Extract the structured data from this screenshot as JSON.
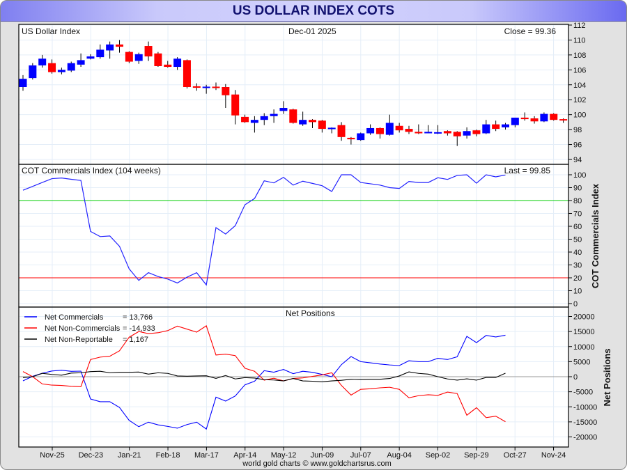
{
  "title": "US DOLLAR INDEX COTS",
  "colors": {
    "up": "#0000ff",
    "down": "#ff0000",
    "commercials": "#0000ff",
    "non_commercials": "#ff0000",
    "non_reportable": "#000000",
    "grid": "#e4eef8",
    "line80": "#00cc00",
    "line20": "#ff0000"
  },
  "credit": "world gold charts © www.goldchartsrus.com",
  "chart_data": [
    {
      "type": "candlestick",
      "title": "US Dollar Index",
      "date_label": "Dec-01  2025",
      "close_label": "Close = 99.36",
      "ylim": [
        94,
        112
      ],
      "yticks": [
        "94",
        "96",
        "98",
        "100",
        "102",
        "104",
        "106",
        "108",
        "110",
        "112"
      ],
      "ohlc": [
        [
          103.7,
          105.3,
          103.2,
          104.8
        ],
        [
          104.9,
          106.9,
          104.7,
          106.6
        ],
        [
          106.6,
          108.0,
          106.3,
          107.5
        ],
        [
          106.9,
          107.4,
          105.5,
          105.7
        ],
        [
          105.7,
          106.3,
          105.4,
          106.0
        ],
        [
          105.9,
          107.1,
          105.7,
          106.9
        ],
        [
          106.7,
          108.2,
          106.4,
          107.3
        ],
        [
          107.5,
          108.1,
          107.4,
          107.8
        ],
        [
          107.7,
          109.4,
          107.5,
          108.7
        ],
        [
          108.6,
          109.8,
          107.5,
          109.4
        ],
        [
          109.4,
          110.0,
          108.3,
          109.1
        ],
        [
          108.4,
          108.5,
          106.9,
          107.1
        ],
        [
          107.2,
          108.3,
          106.8,
          108.1
        ],
        [
          109.2,
          109.8,
          107.2,
          107.8
        ],
        [
          108.2,
          108.4,
          106.4,
          106.5
        ],
        [
          106.7,
          107.2,
          106.3,
          106.4
        ],
        [
          106.4,
          107.7,
          106.0,
          107.5
        ],
        [
          107.3,
          107.4,
          103.5,
          103.7
        ],
        [
          103.8,
          104.2,
          103.2,
          103.6
        ],
        [
          103.7,
          104.0,
          102.8,
          103.75
        ],
        [
          103.75,
          104.3,
          103.3,
          103.6
        ],
        [
          103.7,
          104.1,
          100.9,
          102.6
        ],
        [
          102.7,
          103.3,
          98.7,
          99.9
        ],
        [
          99.7,
          100.0,
          98.9,
          99.0
        ],
        [
          98.9,
          99.8,
          97.6,
          99.3
        ],
        [
          99.3,
          100.2,
          98.6,
          99.8
        ],
        [
          99.8,
          100.7,
          98.9,
          100.1
        ],
        [
          100.5,
          101.8,
          100.1,
          100.9
        ],
        [
          100.7,
          100.8,
          98.8,
          98.9
        ],
        [
          98.7,
          100.4,
          98.5,
          99.3
        ],
        [
          99.3,
          99.4,
          98.2,
          99.0
        ],
        [
          99.2,
          99.3,
          97.6,
          98.1
        ],
        [
          98.2,
          98.3,
          97.5,
          98.25
        ],
        [
          98.6,
          99.0,
          96.5,
          97.0
        ],
        [
          96.9,
          97.0,
          96.0,
          96.7
        ],
        [
          96.6,
          97.6,
          96.5,
          97.5
        ],
        [
          97.5,
          98.7,
          97.3,
          98.2
        ],
        [
          98.2,
          98.3,
          96.8,
          97.4
        ],
        [
          97.3,
          100.0,
          97.2,
          98.9
        ],
        [
          98.5,
          98.9,
          97.6,
          97.9
        ],
        [
          98.1,
          98.5,
          97.4,
          97.7
        ],
        [
          97.7,
          98.7,
          97.4,
          97.5
        ],
        [
          97.5,
          98.6,
          97.5,
          97.7
        ],
        [
          97.55,
          98.6,
          97.4,
          97.65
        ],
        [
          97.8,
          97.9,
          97.2,
          97.5
        ],
        [
          97.7,
          97.8,
          95.8,
          97.1
        ],
        [
          97.2,
          98.3,
          96.8,
          97.8
        ],
        [
          97.9,
          98.0,
          97.1,
          97.4
        ],
        [
          97.5,
          99.3,
          97.4,
          98.7
        ],
        [
          98.7,
          99.2,
          97.8,
          98.1
        ],
        [
          98.3,
          98.9,
          98.0,
          98.7
        ],
        [
          98.6,
          99.6,
          98.3,
          99.6
        ],
        [
          99.6,
          100.3,
          99.2,
          99.4
        ],
        [
          99.5,
          99.8,
          98.8,
          99.1
        ],
        [
          99.1,
          100.3,
          99.0,
          100.1
        ],
        [
          100.1,
          100.2,
          99.2,
          99.3
        ],
        [
          99.4,
          99.5,
          98.9,
          99.36
        ]
      ]
    },
    {
      "type": "line",
      "title": "COT Commercials Index (104 weeks)",
      "last_label": "Last = 99.85",
      "ylabel": "COT Commercials Index",
      "ylim": [
        0,
        100
      ],
      "yticks": [
        "0",
        "10",
        "20",
        "30",
        "40",
        "50",
        "60",
        "70",
        "80",
        "90",
        "100"
      ],
      "reference_lines": [
        80,
        20
      ],
      "values": [
        88,
        91,
        94,
        97,
        97.5,
        96.5,
        95.6,
        56,
        52,
        52.5,
        44.5,
        27,
        18,
        24,
        21,
        19,
        16,
        20.5,
        24,
        14.5,
        59,
        54,
        60.5,
        76.7,
        81.6,
        95.3,
        93.7,
        98,
        92,
        95,
        93.3,
        91.5,
        87,
        100,
        100,
        94,
        93,
        92,
        90,
        89.4,
        94.8,
        94,
        94,
        97.7,
        96.4,
        99.5,
        100,
        93.5,
        100,
        98.4,
        99.85
      ]
    },
    {
      "type": "line",
      "title": "Net Positions",
      "ylabel": "Net Positions",
      "ylim": [
        -20000,
        20000
      ],
      "yticks": [
        "-20000",
        "-15000",
        "-10000",
        "-5000",
        "0",
        "5000",
        "10000",
        "15000",
        "20000"
      ],
      "xticks": [
        "Nov-25",
        "Dec-23",
        "Jan-21",
        "Feb-18",
        "Mar-17",
        "Apr-14",
        "May-12",
        "Jun-09",
        "Jul-07",
        "Aug-04",
        "Sep-02",
        "Sep-29",
        "Oct-27",
        "Nov-24"
      ],
      "series": [
        {
          "name": "Net Commercials",
          "value_label": "= 13,766",
          "values": [
            -1400,
            150,
            1150,
            1900,
            2150,
            1770,
            1850,
            -7400,
            -8300,
            -8300,
            -10200,
            -14500,
            -16600,
            -15100,
            -16000,
            -16500,
            -17100,
            -15900,
            -15100,
            -17400,
            -6800,
            -8100,
            -6400,
            -2700,
            -1500,
            2000,
            1500,
            2400,
            1000,
            1800,
            1450,
            760,
            0,
            4000,
            6700,
            5000,
            4600,
            4200,
            3900,
            3700,
            5300,
            5000,
            5000,
            6100,
            5700,
            6600,
            13400,
            11300,
            13700,
            13200,
            13766
          ]
        },
        {
          "name": "Net Non-Commercials",
          "value_label": "= -14,933",
          "values": [
            1700,
            0,
            -2400,
            -2800,
            -2900,
            -3200,
            -3300,
            5700,
            6500,
            6800,
            8600,
            13100,
            15000,
            14300,
            14600,
            15300,
            16800,
            15800,
            14800,
            16900,
            7200,
            7500,
            7000,
            2800,
            1800,
            -1150,
            -500,
            -1400,
            -600,
            -400,
            100,
            600,
            1300,
            -2900,
            -6100,
            -4200,
            -4000,
            -3700,
            -3500,
            -4200,
            -7000,
            -6300,
            -6000,
            -6200,
            -5100,
            -5600,
            -12800,
            -10300,
            -13600,
            -13100,
            -14933
          ]
        },
        {
          "name": "Net Non-Reportable",
          "value_label": "= 1,167",
          "values": [
            -300,
            0,
            1100,
            750,
            500,
            1200,
            1300,
            1700,
            1800,
            1300,
            1450,
            1450,
            1550,
            850,
            1300,
            1100,
            250,
            150,
            250,
            300,
            -550,
            400,
            -750,
            -300,
            -450,
            -1000,
            -1100,
            -1400,
            -600,
            -1400,
            -1500,
            -1700,
            -1400,
            -1200,
            -850,
            -900,
            -850,
            -850,
            -600,
            250,
            1600,
            1100,
            850,
            0,
            -750,
            -1150,
            -700,
            -1150,
            -250,
            -250,
            1167
          ]
        }
      ]
    }
  ]
}
